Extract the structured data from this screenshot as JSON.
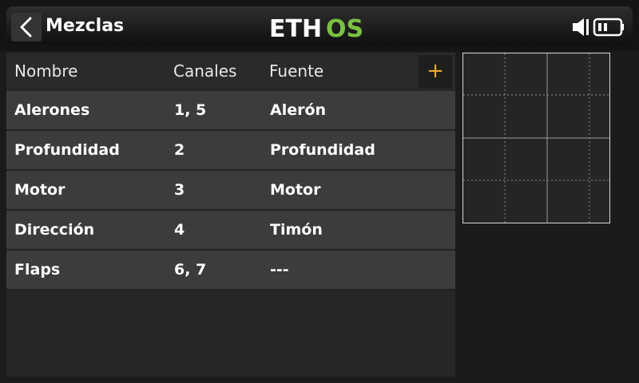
{
  "header": {
    "title": "Mezclas",
    "logo_text_left": "ETH",
    "logo_text_right": "OS",
    "logo_accent_color": "#7ac142"
  },
  "table": {
    "columns": [
      "Nombre",
      "Canales",
      "Fuente"
    ],
    "add_label": "+",
    "rows": [
      {
        "name": "Alerones",
        "channels": "1, 5",
        "source": "Alerón"
      },
      {
        "name": "Profundidad",
        "channels": "2",
        "source": "Profundidad"
      },
      {
        "name": "Motor",
        "channels": "3",
        "source": "Motor"
      },
      {
        "name": "Dirección",
        "channels": "4",
        "source": "Timón"
      },
      {
        "name": "Flaps",
        "channels": "6, 7",
        "source": "---"
      }
    ]
  },
  "colors": {
    "accent_orange": "#f0a830",
    "row_bg": "#3c3c3c"
  },
  "icons": [
    "back-arrow-icon",
    "speaker-icon",
    "battery-icon",
    "add-icon"
  ]
}
